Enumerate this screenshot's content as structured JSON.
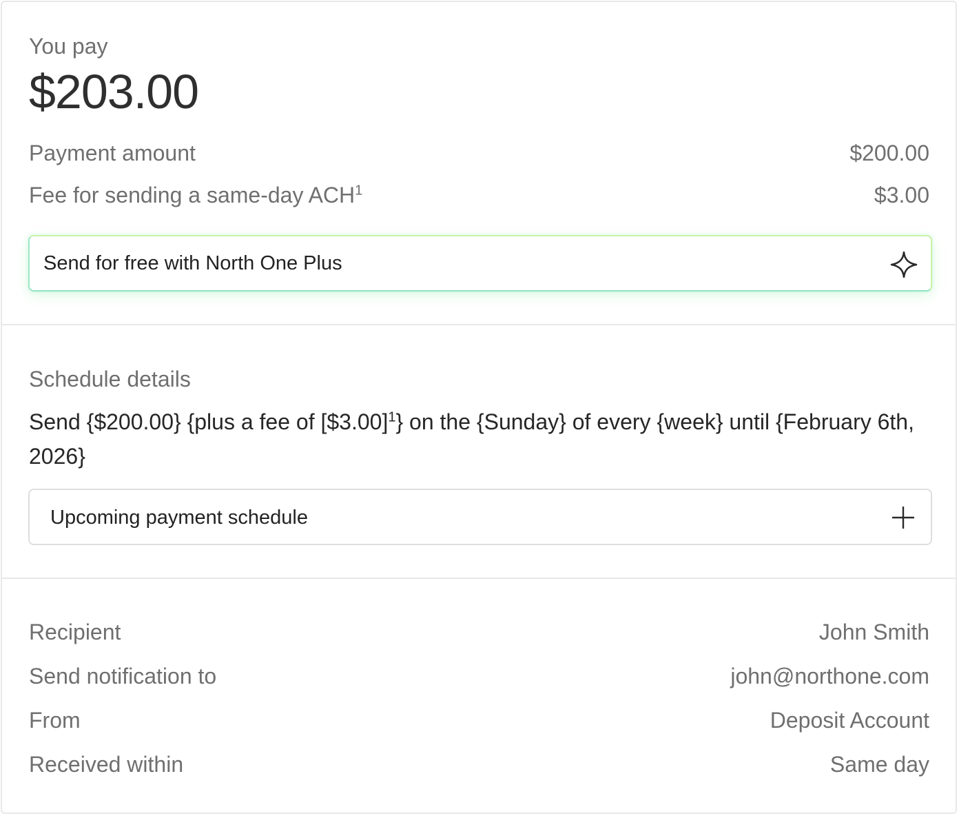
{
  "summary": {
    "you_pay_label": "You pay",
    "total": "$203.00",
    "payment_amount_label": "Payment amount",
    "payment_amount_value": "$200.00",
    "fee_label": "Fee for sending a same-day ACH",
    "fee_footnote": "1",
    "fee_value": "$3.00"
  },
  "promo": {
    "label": "Send for free with North One Plus",
    "icon": "sparkle-icon"
  },
  "schedule": {
    "title": "Schedule details",
    "text_part1": "Send {$200.00} {plus a fee of [$3.00]",
    "text_footnote": "1",
    "text_part2": "} on the {Sunday} of every {week} until {February 6th, 2026}",
    "accordion_label": "Upcoming payment schedule",
    "accordion_icon": "plus-icon"
  },
  "details": {
    "rows": [
      {
        "label": "Recipient",
        "value": "John Smith"
      },
      {
        "label": "Send notification to",
        "value": "john@northone.com"
      },
      {
        "label": "From",
        "value": "Deposit Account"
      },
      {
        "label": "Received within",
        "value": "Same day"
      }
    ]
  },
  "colors": {
    "muted_text": "#6f6f6f",
    "dark_text": "#2f2f2f",
    "promo_border_green": "#c7f3a8",
    "promo_border_teal": "#8fe3c7",
    "divider": "#e8e8e8"
  }
}
